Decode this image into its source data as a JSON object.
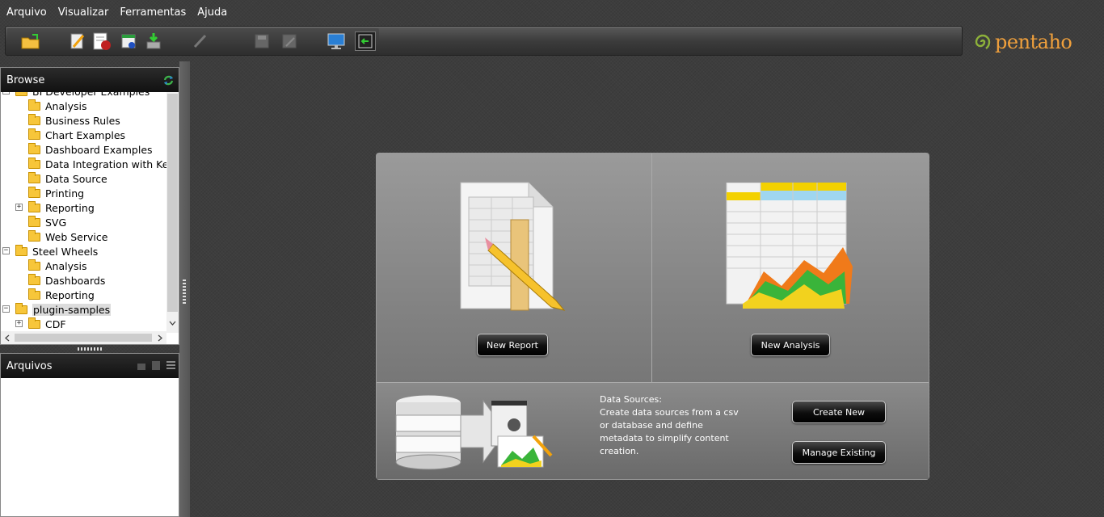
{
  "menu": [
    "Arquivo",
    "Visualizar",
    "Ferramentas",
    "Ajuda"
  ],
  "logo": "pentaho",
  "browse": {
    "title": "Browse",
    "tree": [
      {
        "label": "BI Developer Examples",
        "level": 0,
        "expander": "−"
      },
      {
        "label": "Analysis",
        "level": 1,
        "expander": ""
      },
      {
        "label": "Business Rules",
        "level": 1,
        "expander": ""
      },
      {
        "label": "Chart Examples",
        "level": 1,
        "expander": ""
      },
      {
        "label": "Dashboard Examples",
        "level": 1,
        "expander": ""
      },
      {
        "label": "Data Integration with Kettle",
        "level": 1,
        "expander": ""
      },
      {
        "label": "Data Source",
        "level": 1,
        "expander": ""
      },
      {
        "label": "Printing",
        "level": 1,
        "expander": ""
      },
      {
        "label": "Reporting",
        "level": 1,
        "expander": "+"
      },
      {
        "label": "SVG",
        "level": 1,
        "expander": ""
      },
      {
        "label": "Web Service",
        "level": 1,
        "expander": ""
      },
      {
        "label": "Steel Wheels",
        "level": 0,
        "expander": "−"
      },
      {
        "label": "Analysis",
        "level": 1,
        "expander": ""
      },
      {
        "label": "Dashboards",
        "level": 1,
        "expander": ""
      },
      {
        "label": "Reporting",
        "level": 1,
        "expander": ""
      },
      {
        "label": "plugin-samples",
        "level": 0,
        "expander": "−",
        "selected": true
      },
      {
        "label": "CDF",
        "level": 1,
        "expander": "+"
      }
    ]
  },
  "files": {
    "title": "Arquivos"
  },
  "main": {
    "new_report": "New Report",
    "new_analysis": "New Analysis",
    "datasources_text": "Data Sources:\nCreate data sources from a csv or database and define metadata to simplify content creation.",
    "create_new": "Create New",
    "manage_existing": "Manage Existing"
  },
  "colors": {
    "accent": "#f0a03c",
    "folder": "#f7c63a",
    "header": "#111111"
  }
}
